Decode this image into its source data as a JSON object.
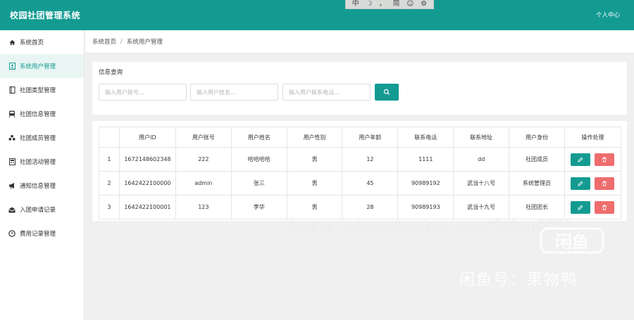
{
  "app": {
    "title": "校园社团管理系统",
    "user_center": "个人中心"
  },
  "ime": {
    "items": [
      "中",
      "☽",
      "，",
      "简",
      "☺",
      "⚙"
    ]
  },
  "sidebar": {
    "items": [
      {
        "label": "系统首页",
        "icon": "home-icon"
      },
      {
        "label": "系统用户管理",
        "icon": "user-card-icon",
        "active": true
      },
      {
        "label": "社团类型管理",
        "icon": "book-icon"
      },
      {
        "label": "社团信息管理",
        "icon": "train-icon"
      },
      {
        "label": "社团成员管理",
        "icon": "group-icon"
      },
      {
        "label": "社团活动管理",
        "icon": "calculator-icon"
      },
      {
        "label": "通知信息管理",
        "icon": "megaphone-icon"
      },
      {
        "label": "入团申请记录",
        "icon": "envelope-icon"
      },
      {
        "label": "费用记录管理",
        "icon": "clock-icon"
      }
    ]
  },
  "breadcrumb": {
    "home": "系统首页",
    "current": "系统用户管理"
  },
  "search": {
    "title": "信息查询",
    "account_placeholder": "输入用户账号...",
    "name_placeholder": "输入用户姓名...",
    "phone_placeholder": "输入用户联系电话..."
  },
  "table": {
    "headers": [
      "",
      "用户ID",
      "用户账号",
      "用户姓名",
      "用户性别",
      "用户年龄",
      "联系电话",
      "联系地址",
      "用户身份",
      "操作处理"
    ],
    "rows": [
      [
        "1",
        "1672148602348",
        "222",
        "哈哈哈哈",
        "男",
        "12",
        "1111",
        "dd",
        "社团成员"
      ],
      [
        "2",
        "1642422100000",
        "admin",
        "张三",
        "男",
        "45",
        "90989192",
        "武当十八号",
        "系统管理员"
      ],
      [
        "3",
        "1642422100001",
        "123",
        "李华",
        "男",
        "28",
        "90989193",
        "武当十九号",
        "社团团长"
      ]
    ]
  },
  "colors": {
    "primary": "#139b92",
    "danger": "#ef6d6d",
    "background": "#f0f0f0"
  },
  "watermark": {
    "url": "https://www.huzhan.com/ishop3572",
    "logo": "闲鱼",
    "text": "闲鱼号：果物鸭"
  }
}
